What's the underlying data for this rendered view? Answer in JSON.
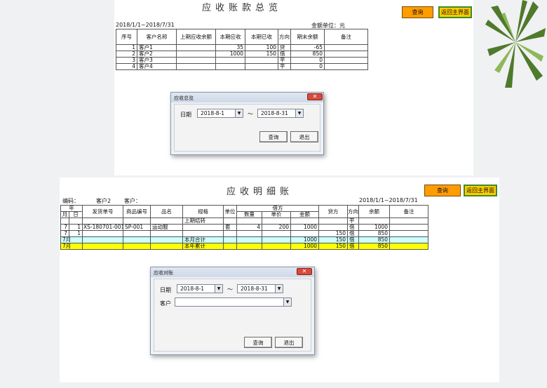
{
  "summary": {
    "title": "应收账款总览",
    "period": "2018/1/1~2018/7/31",
    "unit": "金额单位：元",
    "query_button": "查询",
    "home_button": "返回主界面",
    "headers": [
      "序号",
      "客户名称",
      "上期应收余额",
      "本期应收",
      "本期已收",
      "方向",
      "期末余额",
      "备注"
    ],
    "rows": [
      [
        "1",
        "客户1",
        "",
        "35",
        "100",
        "贷",
        "-65",
        ""
      ],
      [
        "2",
        "客户2",
        "",
        "1000",
        "150",
        "借",
        "850",
        ""
      ],
      [
        "3",
        "客户3",
        "",
        "",
        "",
        "平",
        "0",
        ""
      ],
      [
        "4",
        "客户4",
        "",
        "",
        "",
        "平",
        "0",
        ""
      ]
    ],
    "dialog": {
      "title": "应收总览",
      "date_label": "日期",
      "start_date": "2018-8-1",
      "tilde": "～",
      "end_date": "2018-8-31",
      "query": "查询",
      "exit": "退出"
    }
  },
  "detail": {
    "title": "应收明细账",
    "code_label": "编码：",
    "code_value": "客户2",
    "customer_label": "客户：",
    "period": "2018/1/1~2018/7/31",
    "query_button": "查询",
    "home_button": "返回主界面",
    "head_top": [
      "年",
      "发货单号",
      "商品编号",
      "品名",
      "规格",
      "单位",
      "借方",
      "贷方",
      "方向",
      "余额",
      "备注"
    ],
    "head_month": "月",
    "head_day": "日",
    "head_sub": [
      "数量",
      "单价",
      "金额"
    ],
    "rows": [
      [
        "",
        "",
        "",
        "",
        "",
        "上期结转",
        "",
        "",
        "",
        "",
        "",
        "平",
        "",
        ""
      ],
      [
        "7",
        "1",
        "XS-180701-001",
        "SP-001",
        "运动服",
        "",
        "套",
        "4",
        "200",
        "1000",
        "",
        "借",
        "1000",
        ""
      ],
      [
        "7",
        "1",
        "",
        "",
        "",
        "",
        "",
        "",
        "",
        "",
        "150",
        "借",
        "850",
        ""
      ],
      [
        "7月",
        "",
        "",
        "",
        "",
        "本月合计",
        "",
        "",
        "",
        "1000",
        "150",
        "借",
        "850",
        ""
      ],
      [
        "7月",
        "",
        "",
        "",
        "",
        "本年累计",
        "",
        "",
        "",
        "1000",
        "150",
        "借",
        "850",
        ""
      ]
    ],
    "dialog": {
      "title": "应收对账",
      "date_label": "日期",
      "start_date": "2018-8-1",
      "tilde": "～",
      "end_date": "2018-8-31",
      "customer_label": "客户",
      "customer_value": "",
      "query": "查询",
      "exit": "退出"
    }
  },
  "colors": {
    "orange": "#ff9c00",
    "yellow_row": "#ffff00",
    "cyan_row": "#ccffff"
  }
}
